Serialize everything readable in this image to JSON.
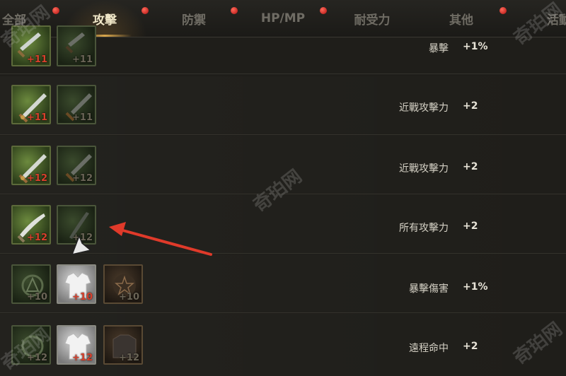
{
  "tabs": [
    {
      "label": "全部",
      "active": false
    },
    {
      "label": "攻擊",
      "active": true
    },
    {
      "label": "防禦",
      "active": false
    },
    {
      "label": "HP/MP",
      "active": false
    },
    {
      "label": "耐受力",
      "active": false
    },
    {
      "label": "其他",
      "active": false
    },
    {
      "label": "活動",
      "active": false
    }
  ],
  "rows": [
    {
      "items": [
        {
          "level": "+11",
          "style": "green"
        },
        {
          "level": "+11",
          "style": "dark"
        }
      ],
      "stat": "暴擊",
      "value": "+1%"
    },
    {
      "items": [
        {
          "level": "+11",
          "style": "green"
        },
        {
          "level": "+11",
          "style": "dark"
        }
      ],
      "stat": "近戰攻擊力",
      "value": "+2"
    },
    {
      "items": [
        {
          "level": "+12",
          "style": "green"
        },
        {
          "level": "+12",
          "style": "dark"
        }
      ],
      "stat": "近戰攻擊力",
      "value": "+2"
    },
    {
      "items": [
        {
          "level": "+12",
          "style": "green"
        },
        {
          "level": "+12",
          "style": "dark"
        }
      ],
      "stat": "所有攻擊力",
      "value": "+2"
    },
    {
      "items": [
        {
          "level": "+10",
          "style": "dark"
        },
        {
          "level": "+10",
          "style": "white"
        },
        {
          "level": "+10",
          "style": "brown"
        }
      ],
      "stat": "暴擊傷害",
      "value": "+1%"
    },
    {
      "items": [
        {
          "level": "+12",
          "style": "dark"
        },
        {
          "level": "+12",
          "style": "white"
        },
        {
          "level": "+12",
          "style": "brown"
        }
      ],
      "stat": "遠程命中",
      "value": "+2"
    }
  ],
  "watermark": "奇珀网",
  "colors": {
    "accent": "#d8a64c",
    "notification_dot": "#d02020",
    "level_text": "#d8402c",
    "arrow": "#e03a2a"
  },
  "icons": [
    "notification-dot-icon",
    "sword-icon",
    "dagger-icon",
    "amulet-icon",
    "shirt-icon",
    "armor-icon",
    "mouse-cursor-icon"
  ]
}
